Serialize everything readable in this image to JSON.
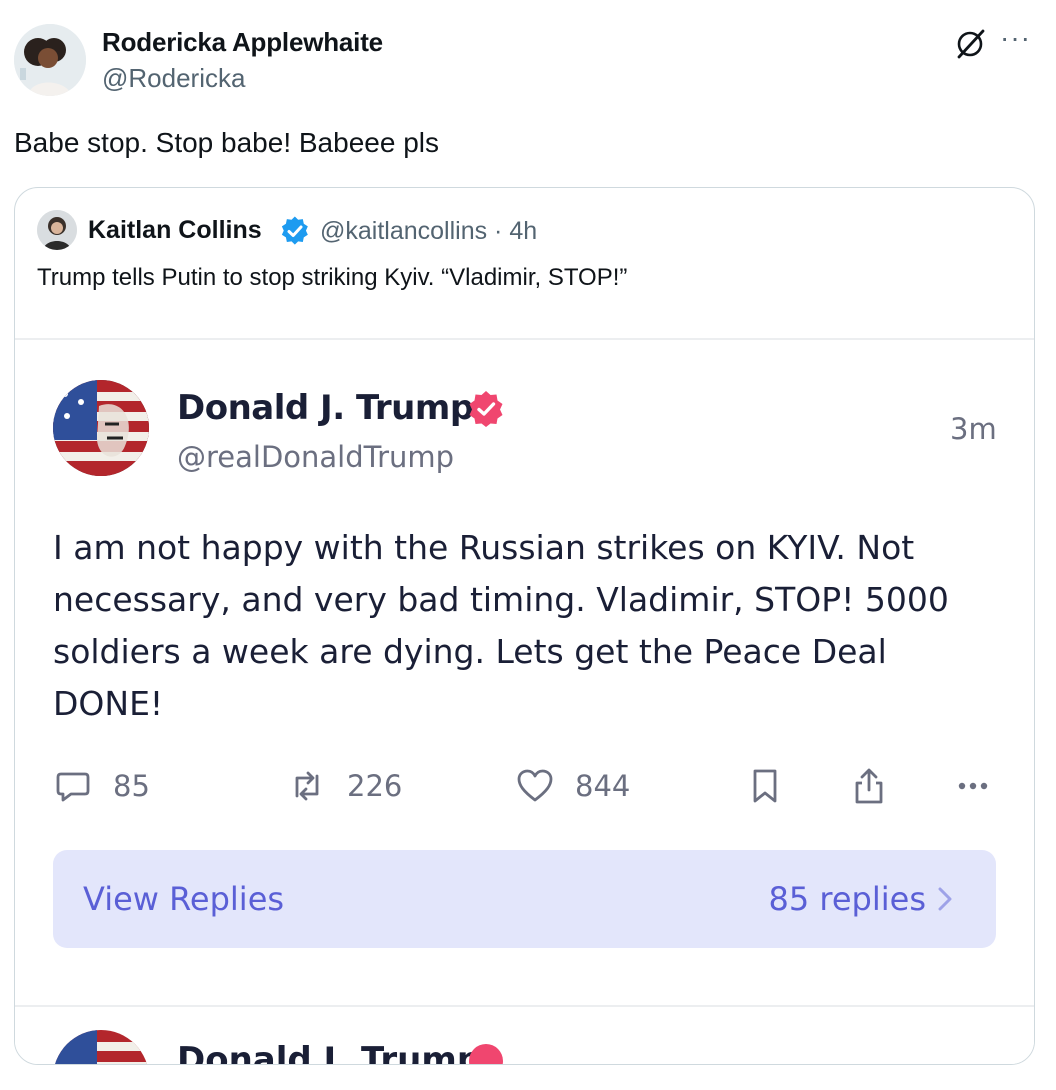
{
  "tweet": {
    "author_name": "Rodericka Applewhaite",
    "author_handle": "@Rodericka",
    "text": "Babe stop. Stop babe! Babeee pls",
    "more_icon": "more-horizontal-icon",
    "grok_icon": "grok-icon"
  },
  "quote": {
    "author_name": "Kaitlan Collins",
    "verified": true,
    "handle_time": "@kaitlancollins · 4h",
    "text": "Trump tells Putin to stop striking Kyiv. “Vladimir, STOP!”",
    "embedded_post": {
      "author_name": "Donald J. Trump",
      "author_handle": "@realDonaldTrump",
      "time": "3m",
      "body": "I am not happy with the Russian strikes on KYIV. Not necessary, and very bad timing. Vladimir, STOP! 5000 soldiers a week are dying. Lets get the Peace Deal DONE!",
      "actions": {
        "replies": "85",
        "reposts": "226",
        "likes": "844"
      },
      "view_replies_label": "View Replies",
      "replies_count_label": "85 replies",
      "next_post_author": "Donald J. Trump"
    }
  },
  "colors": {
    "truth_accent": "#5a5fd6",
    "truth_badge": "#f0466f",
    "x_verified": "#1d9bf0",
    "view_replies_bg": "#e3e6fb"
  }
}
